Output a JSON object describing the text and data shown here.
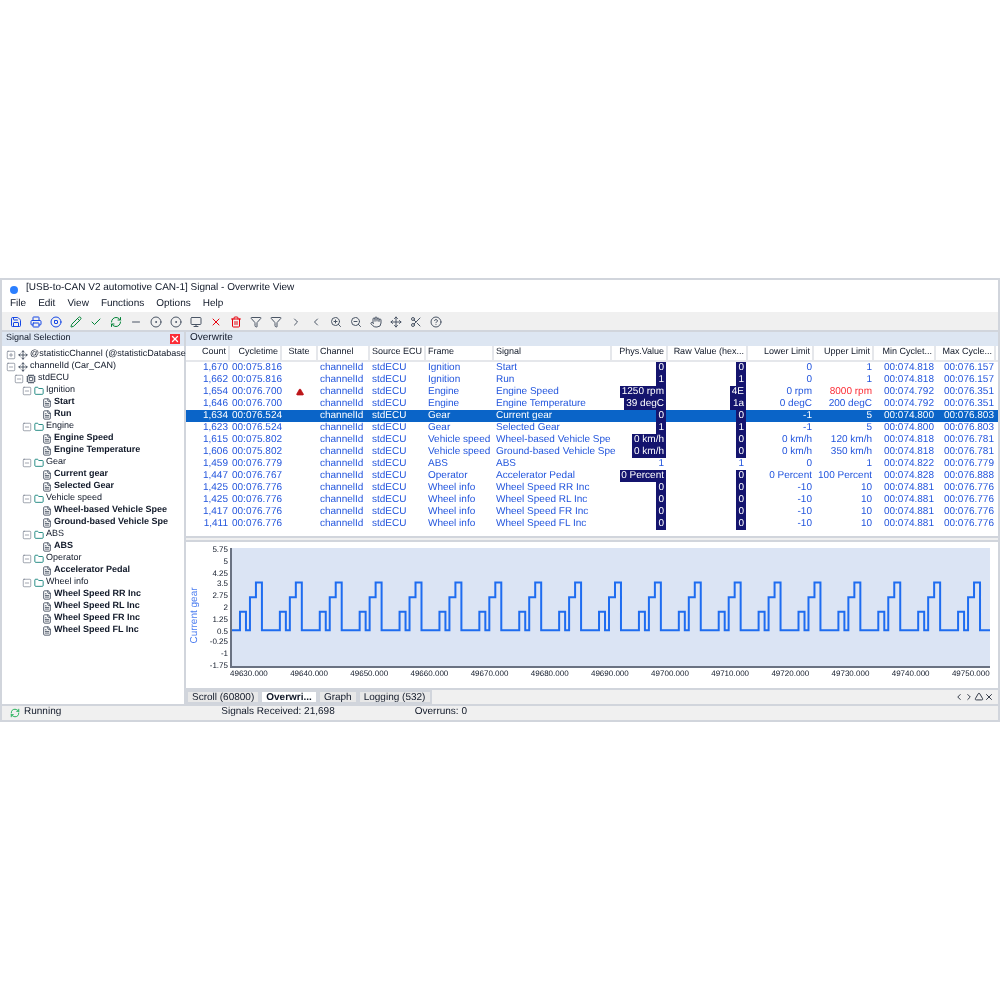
{
  "window": {
    "title": "[USB-to-CAN V2 automotive CAN-1] Signal - Overwrite View"
  },
  "menu": [
    "File",
    "Edit",
    "View",
    "Functions",
    "Options",
    "Help"
  ],
  "signal_selection": {
    "title": "Signal Selection",
    "tree": [
      {
        "label": "@statisticChannel (@statisticDatabase",
        "kind": "channel",
        "expanded": false
      },
      {
        "label": "channelId (Car_CAN)",
        "kind": "channel",
        "expanded": true,
        "children": [
          {
            "label": "stdECU",
            "kind": "ecu",
            "expanded": true,
            "children": [
              {
                "label": "Ignition",
                "kind": "frame",
                "expanded": true,
                "children": [
                  {
                    "label": "Start",
                    "kind": "signal"
                  },
                  {
                    "label": "Run",
                    "kind": "signal"
                  }
                ]
              },
              {
                "label": "Engine",
                "kind": "frame",
                "expanded": true,
                "children": [
                  {
                    "label": "Engine Speed",
                    "kind": "signal"
                  },
                  {
                    "label": "Engine Temperature",
                    "kind": "signal"
                  }
                ]
              },
              {
                "label": "Gear",
                "kind": "frame",
                "expanded": true,
                "children": [
                  {
                    "label": "Current gear",
                    "kind": "signal"
                  },
                  {
                    "label": "Selected Gear",
                    "kind": "signal"
                  }
                ]
              },
              {
                "label": "Vehicle speed",
                "kind": "frame",
                "expanded": true,
                "children": [
                  {
                    "label": "Wheel-based Vehicle Spee",
                    "kind": "signal"
                  },
                  {
                    "label": "Ground-based Vehicle Spe",
                    "kind": "signal"
                  }
                ]
              },
              {
                "label": "ABS",
                "kind": "frame",
                "expanded": true,
                "children": [
                  {
                    "label": "ABS",
                    "kind": "signal"
                  }
                ]
              },
              {
                "label": "Operator",
                "kind": "frame",
                "expanded": true,
                "children": [
                  {
                    "label": "Accelerator Pedal",
                    "kind": "signal"
                  }
                ]
              },
              {
                "label": "Wheel info",
                "kind": "frame",
                "expanded": true,
                "children": [
                  {
                    "label": "Wheel Speed RR Inc",
                    "kind": "signal"
                  },
                  {
                    "label": "Wheel Speed RL Inc",
                    "kind": "signal"
                  },
                  {
                    "label": "Wheel Speed FR Inc",
                    "kind": "signal"
                  },
                  {
                    "label": "Wheel Speed FL Inc",
                    "kind": "signal"
                  }
                ]
              }
            ]
          }
        ]
      }
    ]
  },
  "overwrite": {
    "title": "Overwrite",
    "columns": [
      "Count",
      "Cycletime",
      "State",
      "Channel",
      "Source ECU",
      "Frame",
      "Signal",
      "Phys.Value",
      "Raw Value (hex...",
      "Lower Limit",
      "Upper Limit",
      "Min Cyclet...",
      "Max Cycle..."
    ],
    "rows": [
      {
        "count": "1,670",
        "cycletime": "00:075.816",
        "warning": false,
        "channel": "channelId",
        "ecu": "stdECU",
        "frame": "Ignition",
        "signal": "Start",
        "phys": "0",
        "raw": "0",
        "bar": true,
        "lower": "0",
        "upper": "1",
        "upper_alert": false,
        "min": "00:074.818",
        "max": "00:076.157",
        "selected": false
      },
      {
        "count": "1,662",
        "cycletime": "00:075.816",
        "warning": false,
        "channel": "channelId",
        "ecu": "stdECU",
        "frame": "Ignition",
        "signal": "Run",
        "phys": "1",
        "raw": "1",
        "bar": true,
        "lower": "0",
        "upper": "1",
        "upper_alert": false,
        "min": "00:074.818",
        "max": "00:076.157",
        "selected": false
      },
      {
        "count": "1,654",
        "cycletime": "00:076.700",
        "warning": true,
        "channel": "channelId",
        "ecu": "stdECU",
        "frame": "Engine",
        "signal": "Engine Speed",
        "phys": "1250 rpm",
        "raw": "4E",
        "bar": true,
        "lower": "0 rpm",
        "upper": "8000 rpm",
        "upper_alert": true,
        "min": "00:074.792",
        "max": "00:076.351",
        "selected": false
      },
      {
        "count": "1,646",
        "cycletime": "00:076.700",
        "warning": false,
        "channel": "channelId",
        "ecu": "stdECU",
        "frame": "Engine",
        "signal": "Engine Temperature",
        "phys": "39 degC",
        "raw": "1a",
        "bar": true,
        "lower": "0 degC",
        "upper": "200 degC",
        "upper_alert": false,
        "min": "00:074.792",
        "max": "00:076.351",
        "selected": false
      },
      {
        "count": "1,634",
        "cycletime": "00:076.524",
        "warning": false,
        "channel": "channelId",
        "ecu": "stdECU",
        "frame": "Gear",
        "signal": "Current gear",
        "phys": "0",
        "raw": "0",
        "bar": true,
        "lower": "-1",
        "upper": "5",
        "upper_alert": false,
        "min": "00:074.800",
        "max": "00:076.803",
        "selected": true
      },
      {
        "count": "1,623",
        "cycletime": "00:076.524",
        "warning": false,
        "channel": "channelId",
        "ecu": "stdECU",
        "frame": "Gear",
        "signal": "Selected Gear",
        "phys": "1",
        "raw": "1",
        "bar": true,
        "lower": "-1",
        "upper": "5",
        "upper_alert": false,
        "min": "00:074.800",
        "max": "00:076.803",
        "selected": false
      },
      {
        "count": "1,615",
        "cycletime": "00:075.802",
        "warning": false,
        "channel": "channelId",
        "ecu": "stdECU",
        "frame": "Vehicle speed",
        "signal": "Wheel-based Vehicle Spe",
        "phys": "0 km/h",
        "raw": "0",
        "bar": true,
        "lower": "0 km/h",
        "upper": "120 km/h",
        "upper_alert": false,
        "min": "00:074.818",
        "max": "00:076.781",
        "selected": false
      },
      {
        "count": "1,606",
        "cycletime": "00:075.802",
        "warning": false,
        "channel": "channelId",
        "ecu": "stdECU",
        "frame": "Vehicle speed",
        "signal": "Ground-based Vehicle Spe",
        "phys": "0 km/h",
        "raw": "0",
        "bar": true,
        "lower": "0 km/h",
        "upper": "350 km/h",
        "upper_alert": false,
        "min": "00:074.818",
        "max": "00:076.781",
        "selected": false
      },
      {
        "count": "1,459",
        "cycletime": "00:076.779",
        "warning": false,
        "channel": "channelId",
        "ecu": "stdECU",
        "frame": "ABS",
        "signal": "ABS",
        "phys": "1",
        "raw": "1",
        "bar": false,
        "lower": "0",
        "upper": "1",
        "upper_alert": false,
        "min": "00:074.822",
        "max": "00:076.779",
        "selected": false
      },
      {
        "count": "1,447",
        "cycletime": "00:076.767",
        "warning": false,
        "channel": "channelId",
        "ecu": "stdECU",
        "frame": "Operator",
        "signal": "Accelerator Pedal",
        "phys": "0 Percent",
        "raw": "0",
        "bar": true,
        "lower": "0 Percent",
        "upper": "100 Percent",
        "upper_alert": false,
        "min": "00:074.828",
        "max": "00:076.888",
        "selected": false
      },
      {
        "count": "1,425",
        "cycletime": "00:076.776",
        "warning": false,
        "channel": "channelId",
        "ecu": "stdECU",
        "frame": "Wheel info",
        "signal": "Wheel Speed RR Inc",
        "phys": "0",
        "raw": "0",
        "bar": true,
        "lower": "-10",
        "upper": "10",
        "upper_alert": false,
        "min": "00:074.881",
        "max": "00:076.776",
        "selected": false
      },
      {
        "count": "1,425",
        "cycletime": "00:076.776",
        "warning": false,
        "channel": "channelId",
        "ecu": "stdECU",
        "frame": "Wheel info",
        "signal": "Wheel Speed RL Inc",
        "phys": "0",
        "raw": "0",
        "bar": true,
        "lower": "-10",
        "upper": "10",
        "upper_alert": false,
        "min": "00:074.881",
        "max": "00:076.776",
        "selected": false
      },
      {
        "count": "1,417",
        "cycletime": "00:076.776",
        "warning": false,
        "channel": "channelId",
        "ecu": "stdECU",
        "frame": "Wheel info",
        "signal": "Wheel Speed FR Inc",
        "phys": "0",
        "raw": "0",
        "bar": true,
        "lower": "-10",
        "upper": "10",
        "upper_alert": false,
        "min": "00:074.881",
        "max": "00:076.776",
        "selected": false
      },
      {
        "count": "1,411",
        "cycletime": "00:076.776",
        "warning": false,
        "channel": "channelId",
        "ecu": "stdECU",
        "frame": "Wheel info",
        "signal": "Wheel Speed FL Inc",
        "phys": "0",
        "raw": "0",
        "bar": true,
        "lower": "-10",
        "upper": "10",
        "upper_alert": false,
        "min": "00:074.881",
        "max": "00:076.776",
        "selected": false
      }
    ]
  },
  "graph": {
    "ylabel": "Current gear",
    "yticks": [
      "5.75",
      "5",
      "4.25",
      "3.5",
      "2.75",
      "2",
      "1.25",
      "0.5",
      "-0.25",
      "-1",
      "-1.75"
    ],
    "xticks": [
      "49630.000",
      "49640.000",
      "49650.000",
      "49660.000",
      "49670.000",
      "49680.000",
      "49690.000",
      "49700.000",
      "49710.000",
      "49720.000",
      "49730.000",
      "49740.000",
      "49750.000"
    ]
  },
  "view_tabs": [
    {
      "label": "Scroll (60800)",
      "selected": false
    },
    {
      "label": "Overwri...",
      "selected": true
    },
    {
      "label": "Graph",
      "selected": false
    },
    {
      "label": "Logging (532)",
      "selected": false
    }
  ],
  "status_bar": {
    "state": "Running",
    "received": "Signals Received: 21,698",
    "overruns": "Overruns: 0"
  }
}
